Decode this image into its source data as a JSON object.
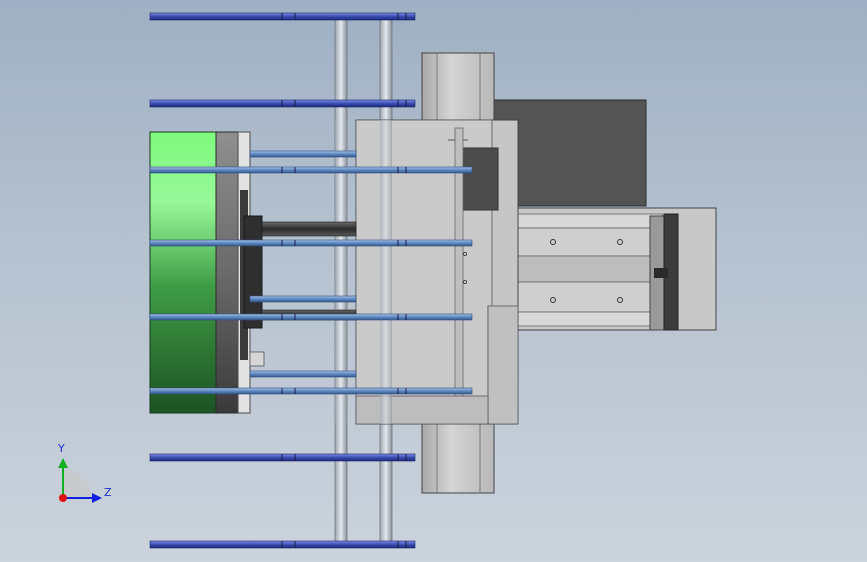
{
  "viewport": {
    "background_top": "#9fb0c4",
    "background_bottom": "#cbd3dc"
  },
  "colors": {
    "green_light": "#8dfc8d",
    "green_dark": "#1e5c26",
    "rod_blue": "#3d4fb5",
    "rod_light_blue": "#6f96c8",
    "frame_grey": "#c4c4c4",
    "frame_dark": "#545454",
    "axis_x": "#e01010",
    "axis_y": "#10b020",
    "axis_z": "#1020e0"
  },
  "triad": {
    "y_label": "Y",
    "z_label": "Z"
  }
}
